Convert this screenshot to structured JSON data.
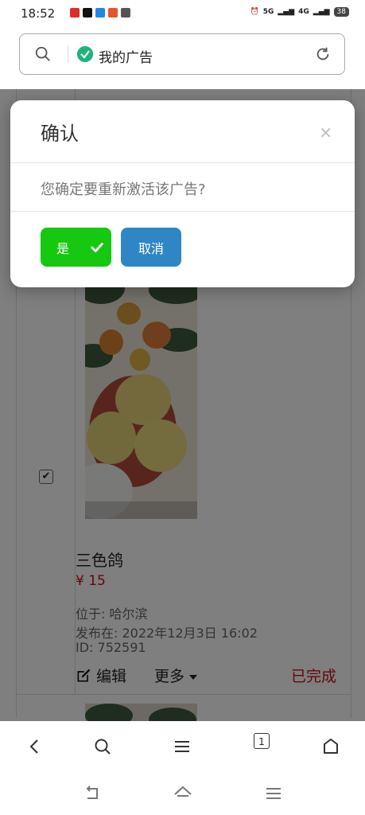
{
  "status_bar": {
    "time": "18:52",
    "network_1": "5G",
    "network_2": "4G",
    "battery": "38"
  },
  "url_bar": {
    "title": "我的广告"
  },
  "ad": {
    "title": "三色鸽",
    "price": "¥ 15",
    "location": "位于: 哈尔滨",
    "published": "发布在: 2022年12月3日 16:02",
    "id": "ID: 752591",
    "edit_label": "编辑",
    "more_label": "更多",
    "status": "已完成",
    "checked": true
  },
  "dialog": {
    "title": "确认",
    "close": "×",
    "message": "您确定要重新激活该广告?",
    "yes_label": "是",
    "cancel_label": "取消"
  },
  "browser_nav": {
    "tabs_count": "1"
  },
  "colors": {
    "yes": "#16c80f",
    "cancel": "#2f86c4",
    "status": "#c1121f",
    "price": "#c1121f"
  }
}
